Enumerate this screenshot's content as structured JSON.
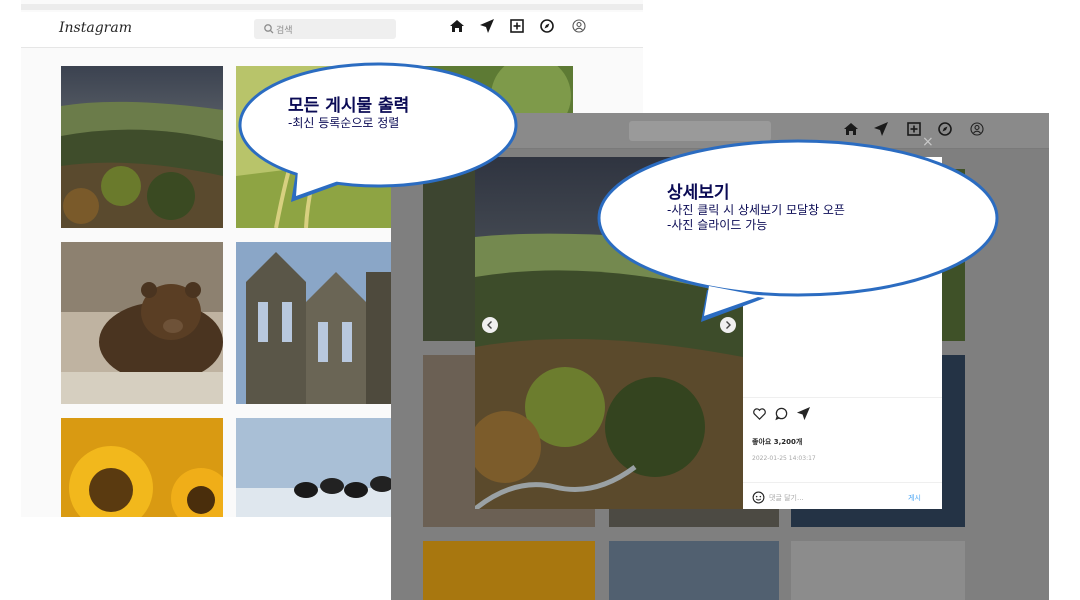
{
  "app": {
    "logo_text": "Instagram",
    "search_placeholder": "검색"
  },
  "nav_icons": [
    "home-icon",
    "send-icon",
    "add-post-icon",
    "explore-icon",
    "profile-icon"
  ],
  "modal": {
    "likes": "좋아요 3,200개",
    "date": "2022-01-25 14:03:17",
    "comment_placeholder": "댓글 달기...",
    "post_button": "게시",
    "close_symbol": "×"
  },
  "callouts": {
    "all_posts": {
      "title": "모든 게시물 출력",
      "lines": [
        "-최신 등록순으로 정렬"
      ]
    },
    "detail": {
      "title": "상세보기",
      "lines": [
        "-사진 클릭 시 상세보기 모달창 오픈",
        "-사진 슬라이드 가능"
      ]
    }
  },
  "colors": {
    "callout_fill": "#2b6cc1",
    "callout_text": "#0b0b55",
    "link_blue": "#4aa5f4",
    "overlay_gray": "#7f7f7f"
  },
  "grid_photos": [
    "landscape",
    "grass",
    "bear",
    "ruins",
    "sunflower",
    "puffins"
  ]
}
